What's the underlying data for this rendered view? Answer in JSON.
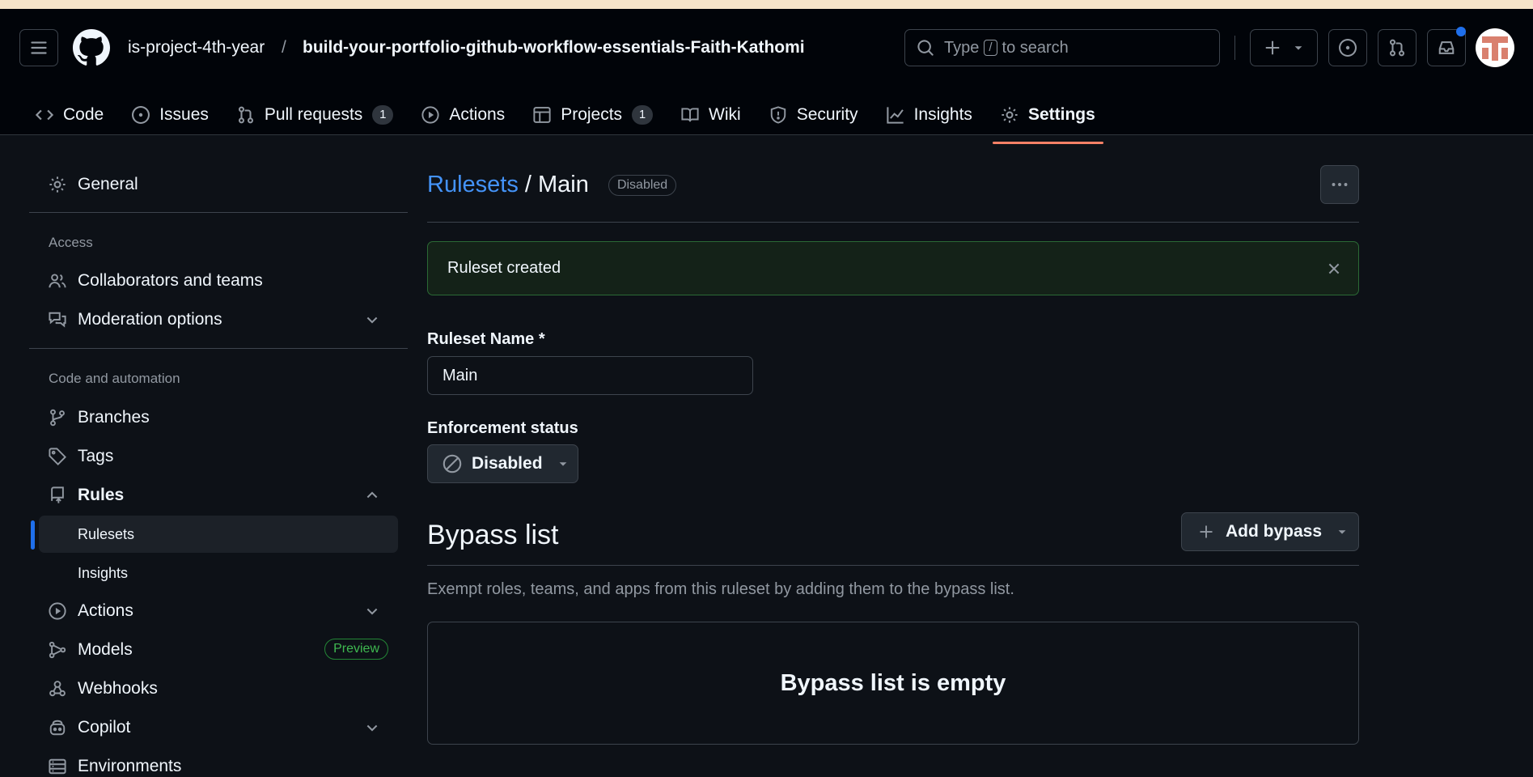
{
  "header": {
    "org": "is-project-4th-year",
    "separator": "/",
    "repo": "build-your-portfolio-github-workflow-essentials-Faith-Kathomi",
    "search": {
      "prefix": "Type",
      "key": "/",
      "suffix": "to search"
    }
  },
  "tabs": [
    {
      "label": "Code",
      "icon": "code-icon"
    },
    {
      "label": "Issues",
      "icon": "issue-icon"
    },
    {
      "label": "Pull requests",
      "icon": "pull-request-icon",
      "count": "1"
    },
    {
      "label": "Actions",
      "icon": "play-icon"
    },
    {
      "label": "Projects",
      "icon": "table-icon",
      "count": "1"
    },
    {
      "label": "Wiki",
      "icon": "book-icon"
    },
    {
      "label": "Security",
      "icon": "shield-icon"
    },
    {
      "label": "Insights",
      "icon": "graph-icon"
    },
    {
      "label": "Settings",
      "icon": "gear-icon",
      "active": true
    }
  ],
  "sidebar": {
    "general": "General",
    "access_heading": "Access",
    "collaborators": "Collaborators and teams",
    "moderation": "Moderation options",
    "code_heading": "Code and automation",
    "branches": "Branches",
    "tags": "Tags",
    "rules": "Rules",
    "rulesets": "Rulesets",
    "insights": "Insights",
    "actions": "Actions",
    "models": "Models",
    "models_badge": "Preview",
    "webhooks": "Webhooks",
    "copilot": "Copilot",
    "environments": "Environments"
  },
  "main": {
    "breadcrumb_link": "Rulesets",
    "breadcrumb_sep": "/",
    "ruleset_title": "Main",
    "status_badge": "Disabled",
    "flash_message": "Ruleset created",
    "name_label": "Ruleset Name *",
    "name_value": "Main",
    "enforcement_label": "Enforcement status",
    "enforcement_value": "Disabled",
    "bypass_heading": "Bypass list",
    "add_bypass": "Add bypass",
    "bypass_description": "Exempt roles, teams, and apps from this ruleset by adding them to the bypass list.",
    "bypass_empty": "Bypass list is empty"
  },
  "colors": {
    "background": "#0d1117",
    "header": "#010409",
    "link": "#4493f8",
    "active_tab_underline": "#f78166",
    "flash_background": "#142218",
    "preview_badge": "#3fb950"
  }
}
